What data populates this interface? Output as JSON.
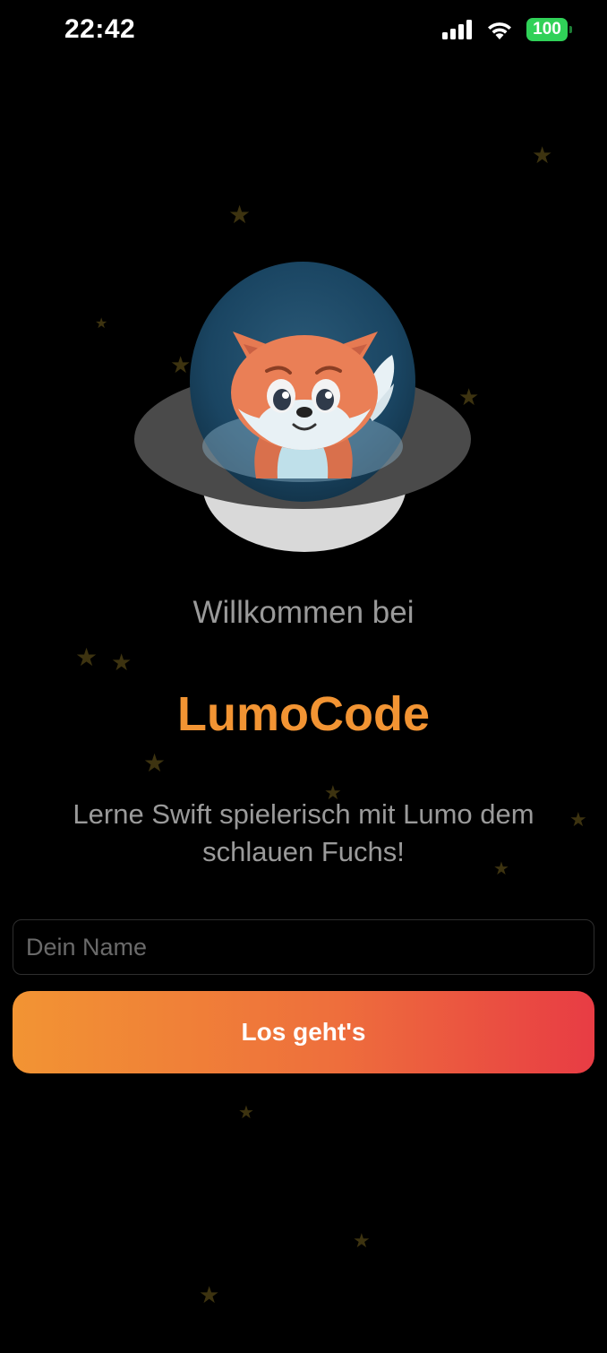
{
  "status_bar": {
    "time": "22:42",
    "battery": "100",
    "signal_icon": "cellular-signal-icon",
    "wifi_icon": "wifi-icon",
    "battery_icon": "battery-icon",
    "battery_color": "#30d158"
  },
  "welcome": {
    "greeting": "Willkommen bei",
    "app_name": "LumoCode",
    "tagline": "Lerne Swift spielerisch mit Lumo dem schlauen Fuchs!"
  },
  "form": {
    "name_value": "",
    "name_placeholder": "Dein Name",
    "start_label": "Los geht's"
  },
  "mascot": {
    "icon": "fox-in-ufo-icon"
  },
  "colors": {
    "accent": "#f29433",
    "gradient_start": "#f29433",
    "gradient_end": "#e83c44",
    "muted_text": "#9a9a9a",
    "background": "#000000"
  }
}
